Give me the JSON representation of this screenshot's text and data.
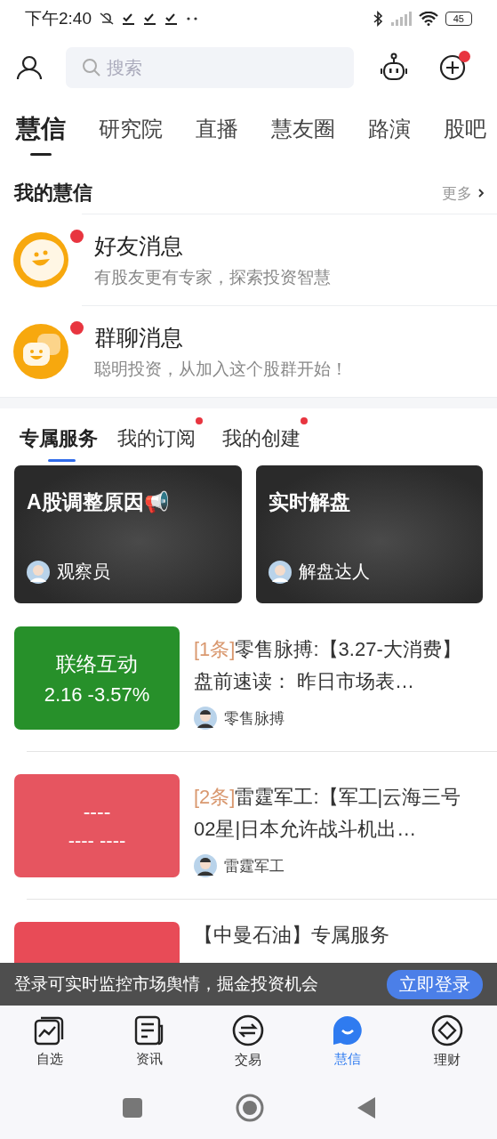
{
  "status_bar": {
    "time": "下午2:40",
    "battery": "45"
  },
  "header": {
    "search": {
      "placeholder": "搜索"
    },
    "add_badge": true
  },
  "tabs": [
    {
      "label": "慧信",
      "selected": true
    },
    {
      "label": "研究院",
      "selected": false
    },
    {
      "label": "直播",
      "selected": false
    },
    {
      "label": "慧友圈",
      "selected": false
    },
    {
      "label": "路演",
      "selected": false
    },
    {
      "label": "股吧",
      "selected": false
    }
  ],
  "my_section": {
    "title": "我的慧信",
    "more": "更多"
  },
  "messages": [
    {
      "kind": "friend",
      "title": "好友消息",
      "subtitle": "有股友更有专家，探索投资智慧",
      "unread": true
    },
    {
      "kind": "group",
      "title": "群聊消息",
      "subtitle": "聪明投资，从加入这个股群开始！",
      "unread": true
    }
  ],
  "sub_tabs": [
    {
      "label": "专属服务",
      "selected": true,
      "dot": false
    },
    {
      "label": "我的订阅",
      "selected": false,
      "dot": true
    },
    {
      "label": "我的创建",
      "selected": false,
      "dot": true
    }
  ],
  "cards": [
    {
      "title": "A股调整原因📢",
      "author": "观察员"
    },
    {
      "title": "实时解盘",
      "author": "解盘达人"
    }
  ],
  "articles": [
    {
      "color": "#27902a",
      "thumb_lines": [
        "联络互动",
        "2.16 -3.57%"
      ],
      "tag": "[1条]",
      "title": "零售脉搏:【3.27-大消费】盘前速读： 昨日市场表…",
      "author": "零售脉搏"
    },
    {
      "color": "#e65560",
      "thumb_lines": [
        "----",
        "---- ----"
      ],
      "tag": "[2条]",
      "title": "雷霆军工:【军工|云海三号02星|日本允许战斗机出…",
      "author": "雷霆军工"
    },
    {
      "color": "#e84b57",
      "title": "【中曼石油】专属服务"
    }
  ],
  "login_banner": {
    "text": "登录可实时监控市场舆情，掘金投资机会",
    "button": "立即登录"
  },
  "bottom_nav": [
    {
      "kind": "watchlist",
      "label": "自选",
      "selected": false
    },
    {
      "kind": "news",
      "label": "资讯",
      "selected": false
    },
    {
      "kind": "trade",
      "label": "交易",
      "selected": false
    },
    {
      "kind": "chat",
      "label": "慧信",
      "selected": true
    },
    {
      "kind": "wealth",
      "label": "理财",
      "selected": false
    }
  ]
}
